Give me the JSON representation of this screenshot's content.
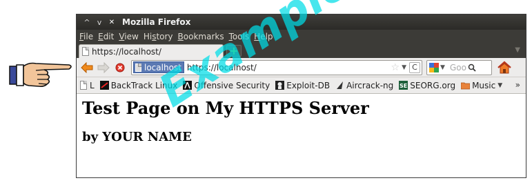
{
  "window": {
    "title": "Mozilla Firefox"
  },
  "menu": [
    "File",
    "Edit",
    "View",
    "History",
    "Bookmarks",
    "Tools",
    "Help"
  ],
  "menu_accel": [
    "F",
    "E",
    "V",
    "s",
    "B",
    "T",
    "H"
  ],
  "tab": {
    "label": "https://localhost/"
  },
  "urlbar": {
    "identity": "localhost",
    "url": "https://localhost/"
  },
  "search": {
    "placeholder": "Goo"
  },
  "bookmarks": [
    {
      "label": "L",
      "icon": "page-icon"
    },
    {
      "label": "BackTrack Linux",
      "icon": "backtrack-icon"
    },
    {
      "label": "Offensive Security",
      "icon": "offsec-icon"
    },
    {
      "label": "Exploit-DB",
      "icon": "exploitdb-icon"
    },
    {
      "label": "Aircrack-ng",
      "icon": "aircrack-icon"
    },
    {
      "label": "SEORG.org",
      "icon": "seorg-icon"
    },
    {
      "label": "Music",
      "icon": "folder-icon"
    }
  ],
  "bookmarks_more": "»",
  "page": {
    "heading": "Test Page on My HTTPS Server",
    "subheading": "by YOUR NAME"
  },
  "watermark": "Example Image",
  "colors": {
    "watermark": "#00dce6",
    "titlebar": "#3c3b37",
    "identity": "#5b79b3"
  }
}
